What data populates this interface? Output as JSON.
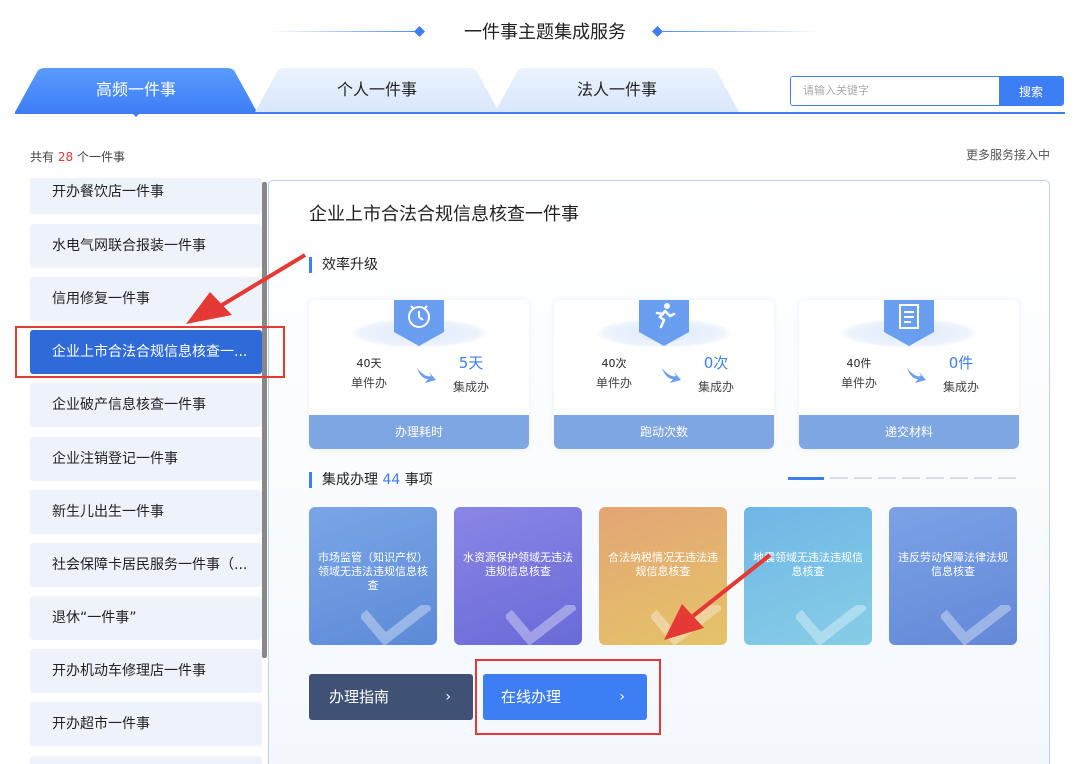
{
  "header": {
    "title": "一件事主题集成服务"
  },
  "tabs": [
    {
      "label": "高频一件事"
    },
    {
      "label": "个人一件事"
    },
    {
      "label": "法人一件事"
    }
  ],
  "search": {
    "placeholder": "请输入关键字",
    "button": "搜索"
  },
  "count": {
    "prefix": "共有",
    "num": "28",
    "suffix": "个一件事"
  },
  "more": "更多服务接入中",
  "sidebar": {
    "items": [
      {
        "label": "开办餐饮店一件事"
      },
      {
        "label": "水电气网联合报装一件事"
      },
      {
        "label": "信用修复一件事"
      },
      {
        "label": "企业上市合法合规信息核查一..."
      },
      {
        "label": "企业破产信息核查一件事"
      },
      {
        "label": "企业注销登记一件事"
      },
      {
        "label": "新生儿出生一件事"
      },
      {
        "label": "社会保障卡居民服务一件事（..."
      },
      {
        "label": "退休“一件事”"
      },
      {
        "label": "开办机动车修理店一件事"
      },
      {
        "label": "开办超市一件事"
      }
    ]
  },
  "main": {
    "title": "企业上市合法合规信息核查一件事",
    "efficiency": {
      "title": "效率升级",
      "cards": [
        {
          "old": "40天",
          "old_label": "单件办",
          "new": "5天",
          "new_label": "集成办",
          "bar": "办理耗时",
          "icon": "clock-icon"
        },
        {
          "old": "40次",
          "old_label": "单件办",
          "new": "0次",
          "new_label": "集成办",
          "bar": "跑动次数",
          "icon": "running-icon"
        },
        {
          "old": "40件",
          "old_label": "单件办",
          "new": "0件",
          "new_label": "集成办",
          "bar": "递交材料",
          "icon": "document-icon"
        }
      ]
    },
    "integrated": {
      "prefix": "集成办理",
      "count": "44",
      "suffix": "事项"
    },
    "items": [
      {
        "label": "市场监管（知识产权）领域无违法违规信息核查"
      },
      {
        "label": "水资源保护领域无违法违规信息核查"
      },
      {
        "label": "合法纳税情况无违法违规信息核查"
      },
      {
        "label": "地震领域无违法违规信息核查"
      },
      {
        "label": "违反劳动保障法律法规信息核查"
      }
    ],
    "buttons": {
      "guide": "办理指南",
      "online": "在线办理",
      "chevron": "›"
    }
  },
  "colors": {
    "primary": "#3e7ef5",
    "annotation": "#e53935",
    "guide_button": "#3f5276"
  }
}
